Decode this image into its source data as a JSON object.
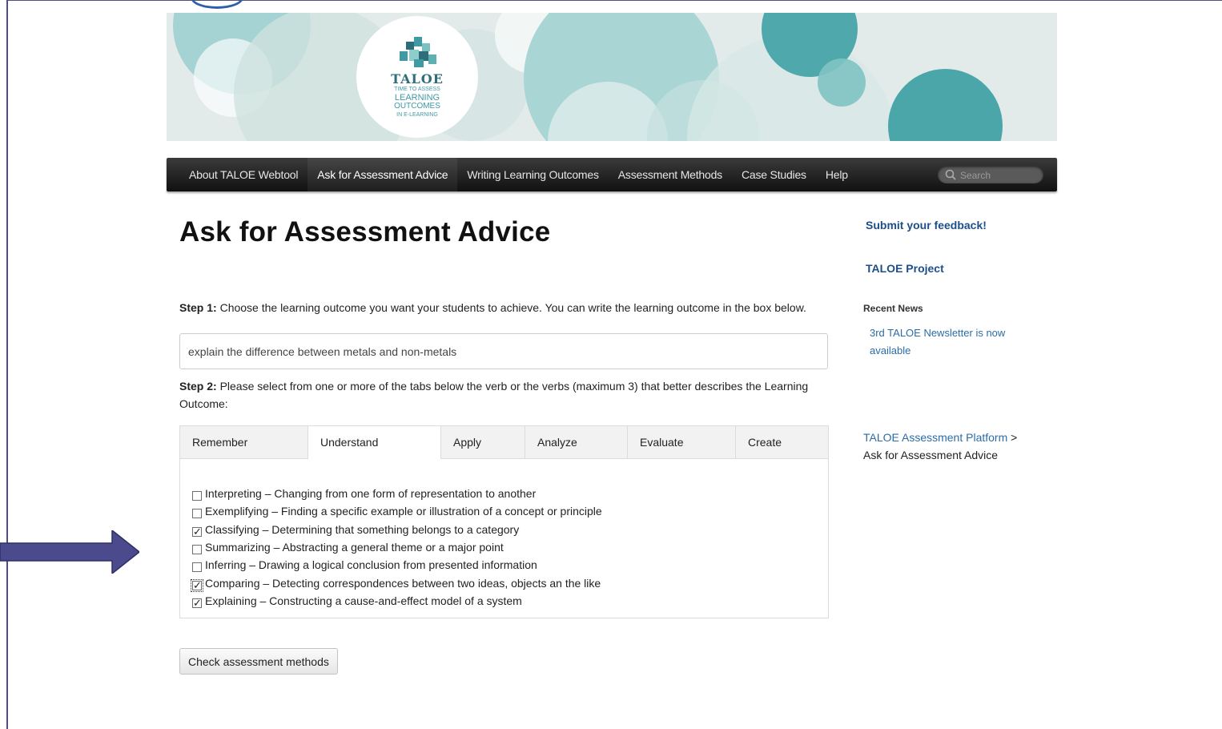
{
  "banner": {
    "logo_title": "TALOE",
    "logo_sub_1": "TIME TO ASSESS",
    "logo_sub_2": "LEARNING",
    "logo_sub_3": "OUTCOMES",
    "logo_sub_4": "IN E-LEARNING"
  },
  "nav": {
    "items": [
      {
        "label": "About TALOE Webtool"
      },
      {
        "label": "Ask for Assessment Advice"
      },
      {
        "label": "Writing Learning Outcomes"
      },
      {
        "label": "Assessment Methods"
      },
      {
        "label": "Case Studies"
      },
      {
        "label": "Help"
      }
    ],
    "active_index": 1,
    "search_placeholder": "Search"
  },
  "main": {
    "title": "Ask for Assessment Advice",
    "step1_label": "Step 1:",
    "step1_text": " Choose the learning outcome you want your students to achieve. You can write the learning outcome in the box below.",
    "outcome_value": "explain the difference between metals and non-metals",
    "step2_label": "Step 2:",
    "step2_text": " Please select from one or more of the tabs below the verb or the verbs (maximum 3) that better describes the Learning Outcome:",
    "tabs": [
      {
        "label": "Remember"
      },
      {
        "label": "Understand"
      },
      {
        "label": "Apply"
      },
      {
        "label": "Analyze"
      },
      {
        "label": "Evaluate"
      },
      {
        "label": "Create"
      }
    ],
    "active_tab": "Understand",
    "options": [
      {
        "label": "Interpreting – Changing from one form of representation to another",
        "checked": false
      },
      {
        "label": "Exemplifying – Finding a specific example or illustration of a concept or principle",
        "checked": false
      },
      {
        "label": "Classifying – Determining that something belongs to a category",
        "checked": true
      },
      {
        "label": "Summarizing – Abstracting a general theme or a major point",
        "checked": false
      },
      {
        "label": "Inferring – Drawing a logical conclusion from presented information",
        "checked": false
      },
      {
        "label": "Comparing – Detecting correspondences between two ideas, objects an the like",
        "checked": true
      },
      {
        "label": "Explaining – Constructing a cause-and-effect model of a system",
        "checked": true
      }
    ],
    "check_button": "Check assessment methods"
  },
  "sidebar": {
    "feedback_link": "Submit your feedback!",
    "project_link": "TALOE Project",
    "recent_news_heading": "Recent News",
    "news_item": "3rd TALOE Newsletter is now available",
    "breadcrumb_link": "TALOE Assessment Platform",
    "breadcrumb_sep": " >",
    "breadcrumb_current": "Ask for Assessment Advice"
  },
  "colors": {
    "teal_dark": "#3f9aa4",
    "teal_light": "#a7d3d3",
    "nav_bg": "#1f1f1f",
    "link_blue": "#1c4f8a",
    "arrow": "#4a4a8c"
  }
}
